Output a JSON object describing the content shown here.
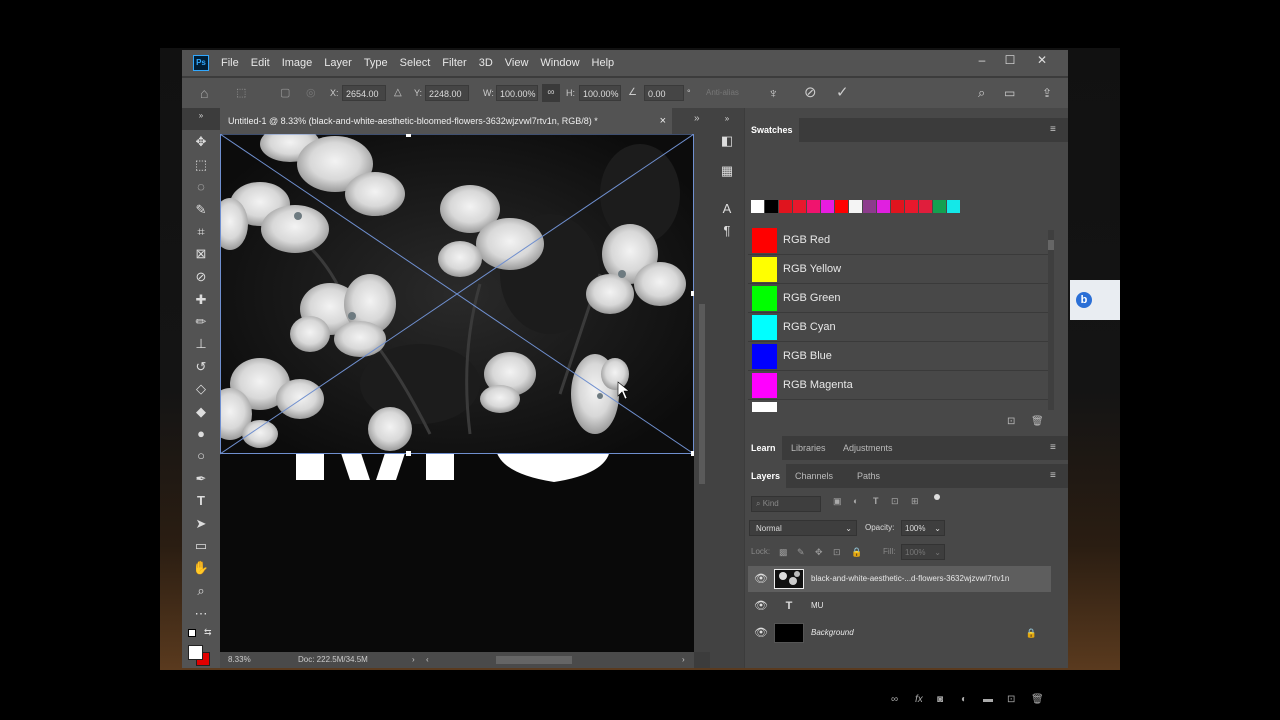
{
  "menubar": {
    "logo": "Ps",
    "items": [
      "File",
      "Edit",
      "Image",
      "Layer",
      "Type",
      "Select",
      "Filter",
      "3D",
      "View",
      "Window",
      "Help"
    ],
    "window_controls": [
      "–",
      "☐",
      "✕"
    ]
  },
  "options": {
    "x_label": "X:",
    "x_value": "2654.00 px",
    "y_label": "Y:",
    "y_value": "2248.00 px",
    "w_label": "W:",
    "w_value": "100.00%",
    "h_label": "H:",
    "h_value": "100.00%",
    "angle_value": "0.00",
    "angle_unit": "°",
    "antialias_label": "Anti-alias",
    "cancel_icon": "⊘",
    "commit_icon": "✓"
  },
  "document": {
    "tab_title": "Untitled-1 @ 8.33% (black-and-white-aesthetic-bloomed-flowers-3632wjzvwl7rtv1n, RGB/8) *",
    "close_icon": "×",
    "canvas_text": "MU",
    "zoom": "8.33%",
    "doc_info": "Doc: 222.5M/34.5M"
  },
  "swatches": {
    "title": "Swatches",
    "chips": [
      "#ffffff",
      "#000000",
      "#e0141e",
      "#e8182c",
      "#f0146e",
      "#e81ce0",
      "#ff0000",
      "#f4f4f4",
      "#8c3c8c",
      "#e020e0",
      "#e0141e",
      "#e8182c",
      "#e01e3c",
      "#14a050",
      "#14e8e8"
    ],
    "items": [
      {
        "name": "RGB Red",
        "color": "#ff0000"
      },
      {
        "name": "RGB Yellow",
        "color": "#ffff00"
      },
      {
        "name": "RGB Green",
        "color": "#00ff00"
      },
      {
        "name": "RGB Cyan",
        "color": "#00ffff"
      },
      {
        "name": "RGB Blue",
        "color": "#0000ff"
      },
      {
        "name": "RGB Magenta",
        "color": "#ff00ff"
      }
    ]
  },
  "panels": {
    "learn_tabs": [
      "Learn",
      "Libraries",
      "Adjustments"
    ],
    "layer_tabs": [
      "Layers",
      "Channels",
      "Paths"
    ],
    "kind_placeholder": "Kind",
    "blend_mode": "Normal",
    "opacity_label": "Opacity:",
    "opacity_value": "100%",
    "lock_label": "Lock:",
    "fill_label": "Fill:",
    "fill_value": "100%"
  },
  "layers": [
    {
      "name": "black-and-white-aesthetic-...d-flowers-3632wjzvwl7rtv1n"
    },
    {
      "name": "MU"
    },
    {
      "name": "Background"
    }
  ]
}
